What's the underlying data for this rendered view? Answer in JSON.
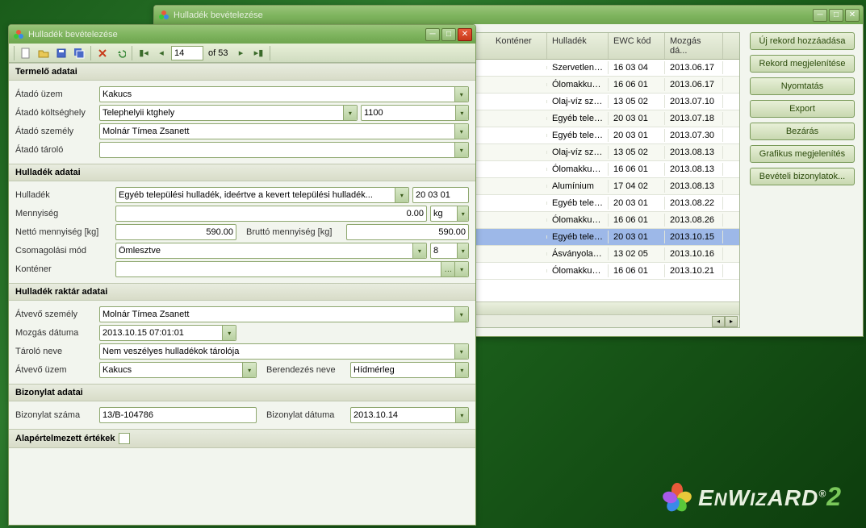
{
  "back_window": {
    "title": "Hulladék bevételezése",
    "table": {
      "headers": [
        "Konténer",
        "Hulladék",
        "EWC kód",
        "Mozgás dá..."
      ],
      "rows": [
        {
          "kontener": "",
          "hulladek": "Szervetlen ...",
          "ewc": "16 03 04",
          "datum": "2013.06.17"
        },
        {
          "kontener": "",
          "hulladek": "Ólomakkum...",
          "ewc": "16 06 01",
          "datum": "2013.06.17"
        },
        {
          "kontener": "",
          "hulladek": "Olaj-víz sze...",
          "ewc": "13 05 02",
          "datum": "2013.07.10"
        },
        {
          "kontener": "",
          "hulladek": "Egyéb telep...",
          "ewc": "20 03 01",
          "datum": "2013.07.18"
        },
        {
          "kontener": "",
          "hulladek": "Egyéb telep...",
          "ewc": "20 03 01",
          "datum": "2013.07.30"
        },
        {
          "kontener": "",
          "hulladek": "Olaj-víz sze...",
          "ewc": "13 05 02",
          "datum": "2013.08.13"
        },
        {
          "kontener": "",
          "hulladek": "Ólomakkum...",
          "ewc": "16 06 01",
          "datum": "2013.08.13"
        },
        {
          "kontener": "",
          "hulladek": "Alumínium",
          "ewc": "17 04 02",
          "datum": "2013.08.13"
        },
        {
          "kontener": "",
          "hulladek": "Egyéb telep...",
          "ewc": "20 03 01",
          "datum": "2013.08.22"
        },
        {
          "kontener": "",
          "hulladek": "Ólomakkum...",
          "ewc": "16 06 01",
          "datum": "2013.08.26"
        },
        {
          "kontener": "",
          "hulladek": "Egyéb telep...",
          "ewc": "20 03 01",
          "datum": "2013.10.15",
          "sel": true
        },
        {
          "kontener": "",
          "hulladek": "Ásványolaj ...",
          "ewc": "13 02 05",
          "datum": "2013.10.16"
        },
        {
          "kontener": "",
          "hulladek": "Ólomakkum...",
          "ewc": "16 06 01",
          "datum": "2013.10.21"
        }
      ]
    },
    "buttons": [
      "Új rekord hozzáadása",
      "Rekord megjelenítése",
      "Nyomtatás",
      "Export",
      "Bezárás",
      "Grafikus megjelenítés",
      "Bevételi bizonylatok..."
    ]
  },
  "front_window": {
    "title": "Hulladék bevételezése",
    "pager": {
      "current": "14",
      "of": "of 53"
    },
    "sections": {
      "termelo": {
        "header": "Termelő adatai",
        "atado_uzem_lbl": "Átadó üzem",
        "atado_uzem": "Kakucs",
        "atado_koltseghely_lbl": "Átadó költséghely",
        "atado_koltseghely": "Telephelyii ktghely",
        "atado_koltseghely_kod": "1100",
        "atado_szemely_lbl": "Átadó személy",
        "atado_szemely": "Molnár Tímea Zsanett",
        "atado_tarolo_lbl": "Átadó tároló",
        "atado_tarolo": ""
      },
      "hulladek": {
        "header": "Hulladék adatai",
        "hulladek_lbl": "Hulladék",
        "hulladek": "Egyéb települési hulladék, ideértve a kevert települési hulladék...",
        "ewc": "20 03 01",
        "mennyiseg_lbl": "Mennyiség",
        "mennyiseg": "0.00",
        "egyseg": "kg",
        "netto_lbl": "Nettó mennyiség [kg]",
        "netto": "590.00",
        "brutto_lbl": "Bruttó mennyiség [kg]",
        "brutto": "590.00",
        "csomagolas_lbl": "Csomagolási mód",
        "csomagolas": "Ömlesztve",
        "csomagolas_val": "8",
        "kontener_lbl": "Konténer",
        "kontener": ""
      },
      "raktar": {
        "header": "Hulladék raktár adatai",
        "atvevo_szemely_lbl": "Átvevő személy",
        "atvevo_szemely": "Molnár Tímea Zsanett",
        "mozgas_datuma_lbl": "Mozgás dátuma",
        "mozgas_datuma": "2013.10.15 07:01:01",
        "tarolo_neve_lbl": "Tároló neve",
        "tarolo_neve": "Nem veszélyes hulladékok tárolója",
        "atvevo_uzem_lbl": "Átvevő üzem",
        "atvevo_uzem": "Kakucs",
        "berendezes_lbl": "Berendezés neve",
        "berendezes": "Hídmérleg"
      },
      "bizonylat": {
        "header": "Bizonylat adatai",
        "szam_lbl": "Bizonylat száma",
        "szam": "13/B-104786",
        "datum_lbl": "Bizonylat dátuma",
        "datum": "2013.10.14"
      },
      "alap": {
        "header": "Alapértelmezett értékek"
      }
    }
  },
  "logo": "EnWizard"
}
